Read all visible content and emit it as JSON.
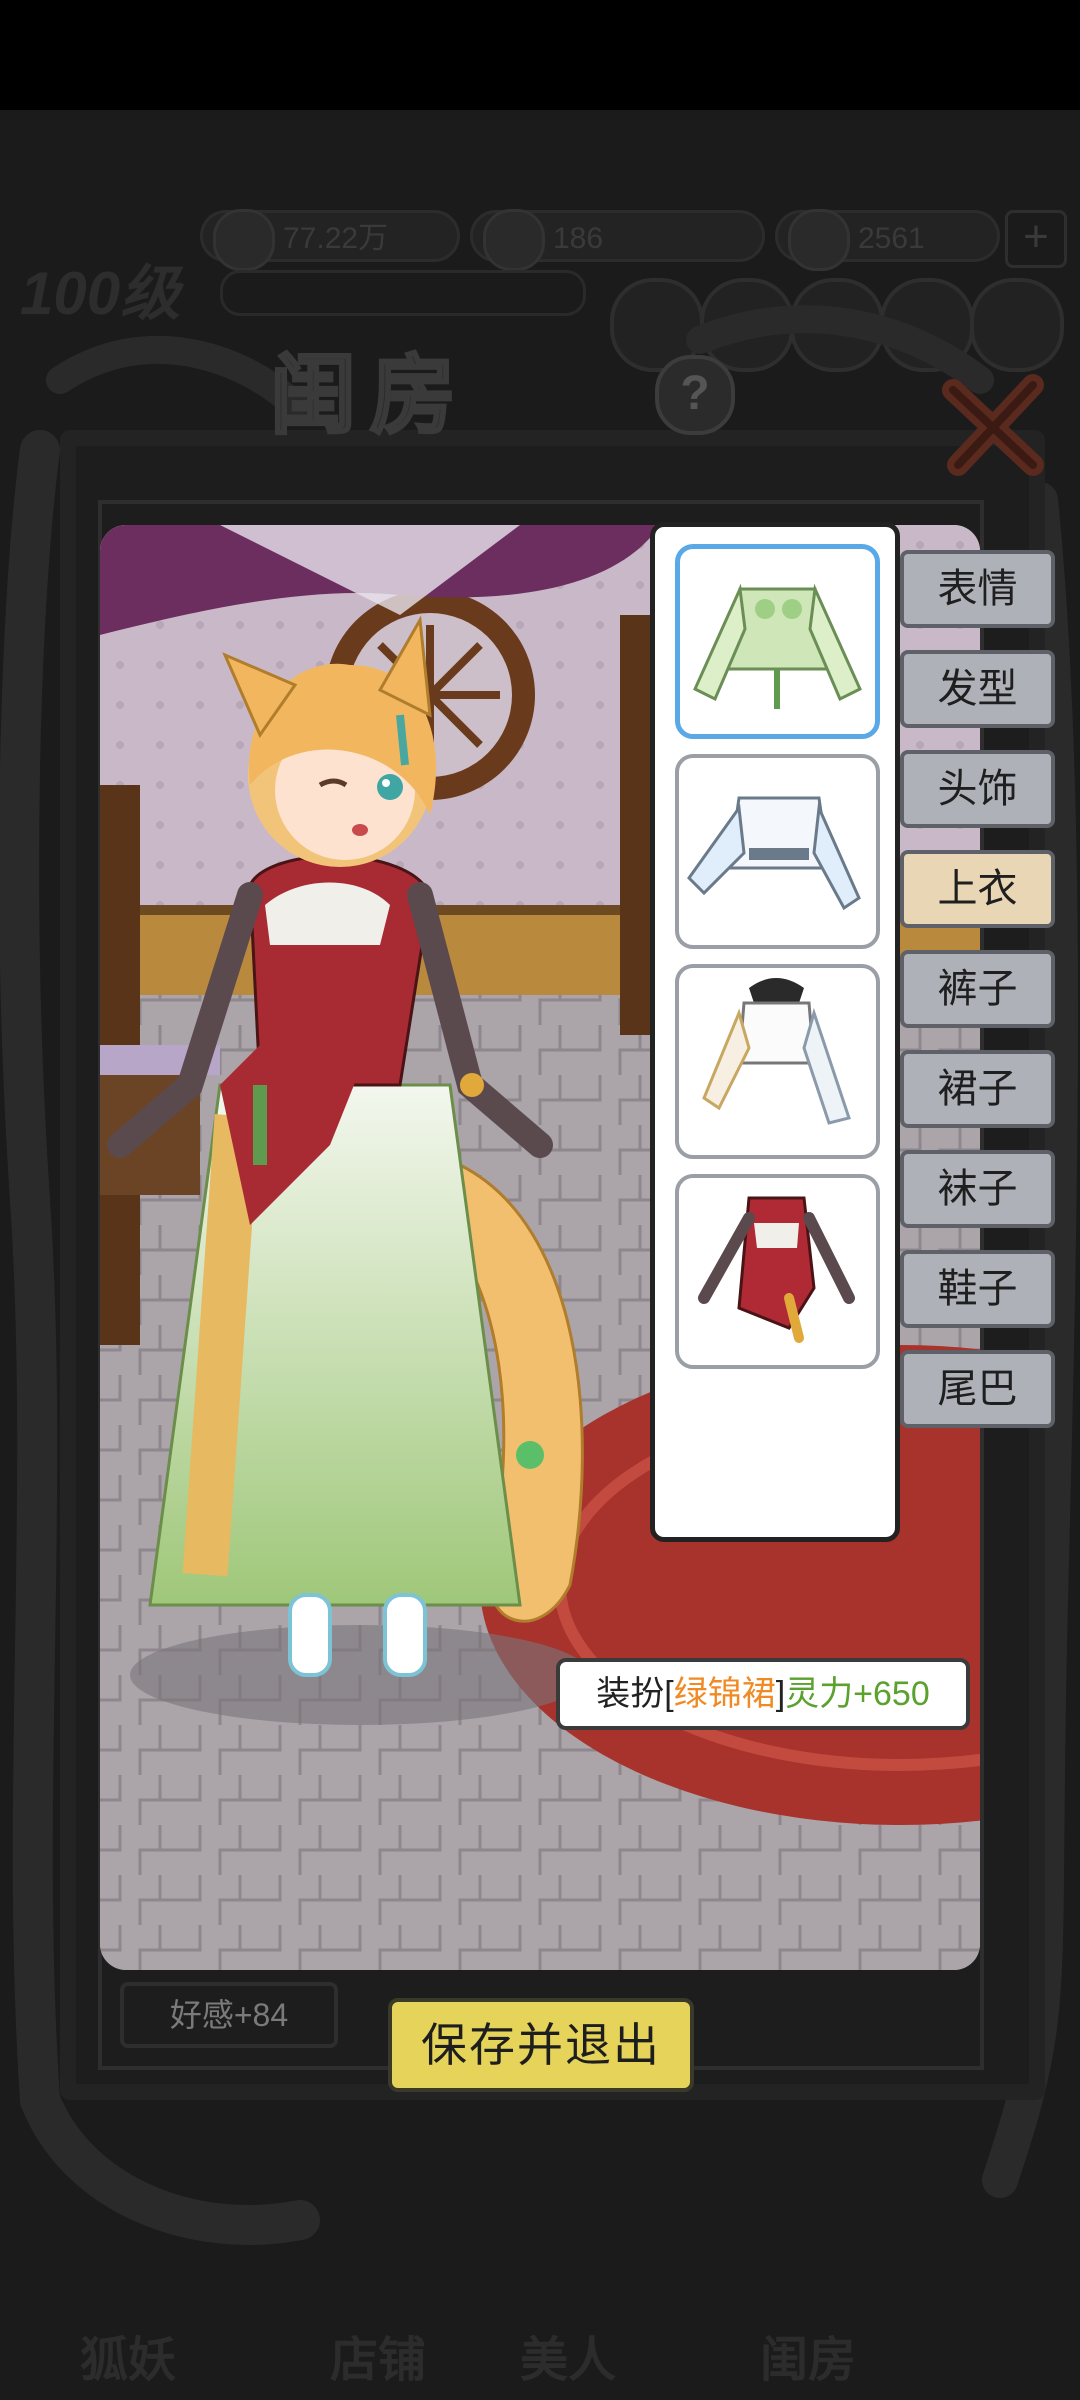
{
  "hud": {
    "level": "100级",
    "currency_1": "77.22万",
    "currency_2": "186",
    "currency_3": "2561",
    "plus_label": "+",
    "bottom_tabs": [
      "狐妖",
      "店铺",
      "美人",
      "闺房"
    ]
  },
  "modal": {
    "title": "闺房",
    "help_label": "?",
    "tabs": [
      {
        "label": "表情",
        "active": false
      },
      {
        "label": "发型",
        "active": false
      },
      {
        "label": "头饰",
        "active": false
      },
      {
        "label": "上衣",
        "active": true
      },
      {
        "label": "裤子",
        "active": false
      },
      {
        "label": "裙子",
        "active": false
      },
      {
        "label": "袜子",
        "active": false
      },
      {
        "label": "鞋子",
        "active": false
      },
      {
        "label": "尾巴",
        "active": false
      }
    ],
    "items": [
      {
        "name": "green-crop-top",
        "selected": true
      },
      {
        "name": "white-blue-top",
        "selected": false
      },
      {
        "name": "white-top-dark-collar",
        "selected": false
      },
      {
        "name": "red-qipao-top",
        "selected": false
      }
    ],
    "toast": {
      "prefix": "装扮[",
      "item_name": "绿锦裙",
      "suffix": "]",
      "bonus": "灵力+650"
    },
    "affection": "好感+84",
    "save_exit_label": "保存并退出"
  },
  "colors": {
    "selected_border": "#5aa9e6",
    "active_tab": "#e9d6b4",
    "tab": "#aeb2b8",
    "save_button": "#e6d45a",
    "toast_item": "#f08a24",
    "toast_bonus": "#5aa12e"
  }
}
